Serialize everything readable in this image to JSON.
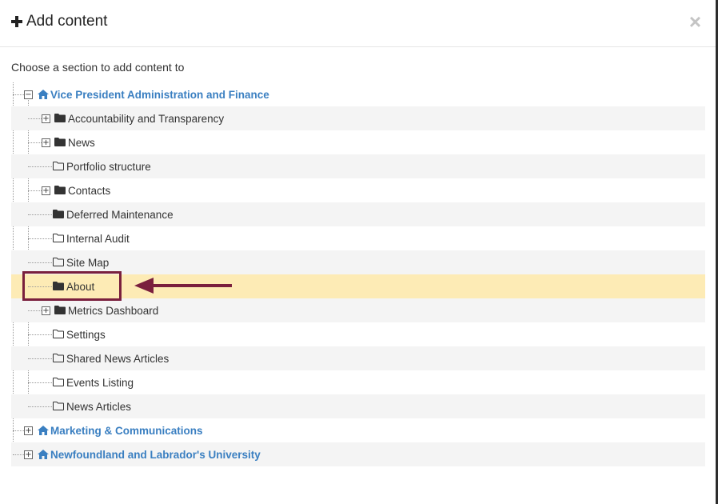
{
  "header": {
    "title": "Add content",
    "close_glyph": "×"
  },
  "instruction": "Choose a section to add content to",
  "tree": [
    {
      "label": "Vice President Administration and Finance",
      "level": 0,
      "toggle": "−",
      "icon": "home-icon"
    },
    {
      "label": "Accountability and Transparency",
      "level": 1,
      "toggle": "+",
      "icon": "folder-filled-icon"
    },
    {
      "label": "News",
      "level": 1,
      "toggle": "+",
      "icon": "folder-filled-icon"
    },
    {
      "label": "Portfolio structure",
      "level": 1,
      "toggle": null,
      "icon": "folder-outline-icon"
    },
    {
      "label": "Contacts",
      "level": 1,
      "toggle": "+",
      "icon": "folder-filled-icon"
    },
    {
      "label": "Deferred Maintenance",
      "level": 1,
      "toggle": null,
      "icon": "folder-filled-icon"
    },
    {
      "label": "Internal Audit",
      "level": 1,
      "toggle": null,
      "icon": "folder-outline-icon"
    },
    {
      "label": "Site Map",
      "level": 1,
      "toggle": null,
      "icon": "folder-outline-icon"
    },
    {
      "label": "About",
      "level": 1,
      "toggle": null,
      "icon": "folder-filled-icon",
      "selected": true
    },
    {
      "label": "Metrics Dashboard",
      "level": 1,
      "toggle": "+",
      "icon": "folder-filled-icon"
    },
    {
      "label": "Settings",
      "level": 1,
      "toggle": null,
      "icon": "folder-outline-icon"
    },
    {
      "label": "Shared News Articles",
      "level": 1,
      "toggle": null,
      "icon": "folder-outline-icon"
    },
    {
      "label": "Events Listing",
      "level": 1,
      "toggle": null,
      "icon": "folder-outline-icon"
    },
    {
      "label": "News Articles",
      "level": 1,
      "toggle": null,
      "icon": "folder-outline-icon"
    },
    {
      "label": "Marketing & Communications",
      "level": 0,
      "toggle": "+",
      "icon": "home-icon"
    },
    {
      "label": "Newfoundland and Labrador's University",
      "level": 0,
      "toggle": "+",
      "icon": "home-icon"
    }
  ],
  "colors": {
    "link": "#3a7fc1",
    "highlight_row": "#fdebb5",
    "annotation": "#7a1f3d",
    "alt_row": "#f4f4f4"
  }
}
